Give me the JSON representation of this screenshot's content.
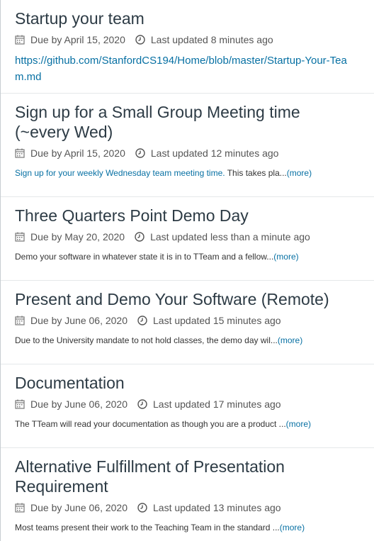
{
  "assignments": [
    {
      "title": "Startup your team",
      "due": "Due by April 15, 2020",
      "updated": "Last updated 8 minutes ago",
      "link": "https://github.com/StanfordCS194/Home/blob/master/Startup-Your-Team.md"
    },
    {
      "title": "Sign up for a Small Group Meeting time (~every Wed)",
      "due": "Due by April 15, 2020",
      "updated": "Last updated 12 minutes ago",
      "desc_link": "Sign up for your weekly Wednesday team meeting time.",
      "desc": " This takes pla...",
      "more": "(more)"
    },
    {
      "title": "Three Quarters Point Demo Day",
      "due": "Due by May 20, 2020",
      "updated": "Last updated less than a minute ago",
      "desc": "Demo your software in whatever state it is in to TTeam and a fellow...",
      "more": "(more)"
    },
    {
      "title": "Present and Demo Your Software (Remote)",
      "due": "Due by June 06, 2020",
      "updated": "Last updated 15 minutes ago",
      "desc": "Due to the University mandate to not hold classes, the demo day wil...",
      "more": "(more)"
    },
    {
      "title": "Documentation",
      "due": "Due by June 06, 2020",
      "updated": "Last updated 17 minutes ago",
      "desc": "The TTeam will read your documentation as though you are a product ...",
      "more": "(more)"
    },
    {
      "title": "Alternative Fulfillment of Presentation Requirement",
      "due": "Due by June 06, 2020",
      "updated": "Last updated 13 minutes ago",
      "desc": "Most teams present their work to the Teaching Team in the standard ...",
      "more": "(more)"
    }
  ]
}
